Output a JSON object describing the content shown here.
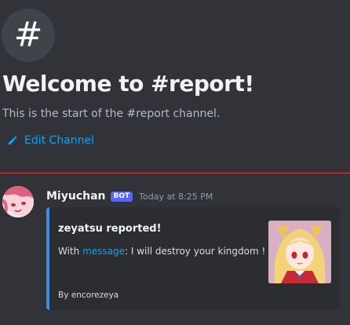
{
  "channel": {
    "icon": "#",
    "welcome_title": "Welcome to #report!",
    "welcome_subtitle": "This is the start of the #report channel.",
    "edit_label": "Edit Channel"
  },
  "message": {
    "author": "Miyuchan",
    "bot_tag": "BOT",
    "timestamp": "Today at 8:25 PM",
    "embed": {
      "accent_color": "#3a8ee6",
      "title": "zeyatsu reported!",
      "desc_prefix": "With ",
      "desc_link": "message",
      "desc_suffix": ": I will destroy your kingdom !",
      "footer": "By encorezeya"
    }
  },
  "colors": {
    "background": "#313338",
    "divider": "#f23f43",
    "link": "#00a8fc",
    "bot_tag": "#5865f2"
  },
  "icons": {
    "channel": "hash-icon",
    "edit": "pencil-icon"
  }
}
